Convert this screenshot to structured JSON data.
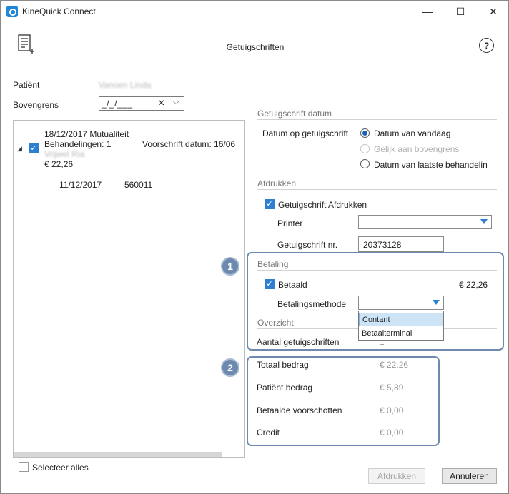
{
  "window": {
    "title": "KineQuick Connect",
    "minimize": "—",
    "maximize": "☐",
    "close": "✕"
  },
  "header": {
    "title": "Getuigschriften",
    "help": "?"
  },
  "patient": {
    "label": "Patiënt",
    "name": "Vanoen Linda"
  },
  "upper_limit": {
    "label": "Bovengrens",
    "value": "_/_/___",
    "clear_icon": "×",
    "dropdown_icon": "⌵"
  },
  "tree": {
    "item": {
      "expand_icon": "◢",
      "line1": "18/12/2017 Mutualiteit",
      "line2_left": "Behandelingen: 1",
      "line2_right": "Voorschrift datum: 16/06",
      "line3": "Vrijwel Ria",
      "amount": "€ 22,26",
      "checked": "✓"
    },
    "subitem": {
      "date": "11/12/2017",
      "code": "560011"
    }
  },
  "select_all": {
    "label": "Selecteer alles"
  },
  "certificate_date": {
    "section": "Getuigschrift datum",
    "label": "Datum op getuigschrift",
    "options": [
      "Datum van vandaag",
      "Gelijk aan bovengrens",
      "Datum van laatste behandelin"
    ]
  },
  "print": {
    "section": "Afdrukken",
    "checkbox_label": "Getuigschrift Afdrukken",
    "printer_label": "Printer",
    "printer_value": "",
    "number_label": "Getuigschrift nr.",
    "number_value": "20373128"
  },
  "payment": {
    "section": "Betaling",
    "paid_label": "Betaald",
    "paid_amount": "€ 22,26",
    "method_label": "Betalingsmethode",
    "method_value": "",
    "options": [
      "Contant",
      "Betaalterminal"
    ]
  },
  "overview": {
    "section": "Overzicht",
    "count_label": "Aantal getuigschriften",
    "count_value": "1",
    "rows": [
      {
        "label": "Totaal bedrag",
        "value": "€ 22,26"
      },
      {
        "label": "Patiënt bedrag",
        "value": "€ 5,89"
      },
      {
        "label": "Betaalde voorschotten",
        "value": "€ 0,00"
      },
      {
        "label": "Credit",
        "value": "€ 0,00"
      }
    ]
  },
  "callouts": [
    "1",
    "2"
  ],
  "buttons": {
    "print": "Afdrukken",
    "cancel": "Annuleren"
  },
  "colors": {
    "accent": "#2d7fd3",
    "callout": "#6d8aae"
  }
}
